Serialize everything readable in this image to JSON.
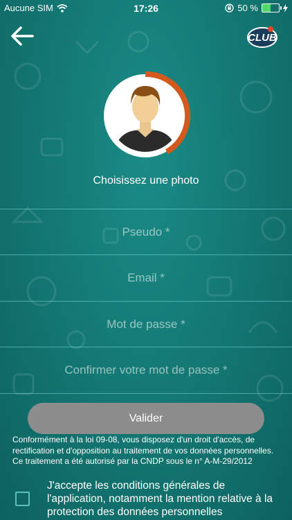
{
  "status_bar": {
    "carrier": "Aucune SIM",
    "time": "17:26",
    "battery": "50 %",
    "battery_level": 0.5
  },
  "header": {
    "back_icon": "arrow-left-icon",
    "logo_text": "CLUB"
  },
  "avatar": {
    "icon": "user-avatar-placeholder",
    "ring_color": "#d35a1c",
    "label": "Choisissez une photo"
  },
  "form": {
    "pseudo_placeholder": "Pseudo *",
    "email_placeholder": "Email *",
    "password_placeholder": "Mot de passe *",
    "confirm_placeholder": "Confirmer votre mot de passe *",
    "submit_label": "Valider"
  },
  "legal": {
    "text": "Conformément à la loi 09-08, vous disposez d'un droit d'accès, de rectification et d'opposition au traitement de vos données personnelles. Ce traitement a été autorisé par la CNDP sous le n° A-M-29/2012"
  },
  "consent": {
    "checked": false,
    "text": "J'accepte les conditions générales de l'application, notamment la mention relative à la protection des données personnelles"
  },
  "colors": {
    "background": "#137571",
    "accent": "#d35a1c",
    "button": "#8d8d8d",
    "divider": "#78dcdc"
  }
}
